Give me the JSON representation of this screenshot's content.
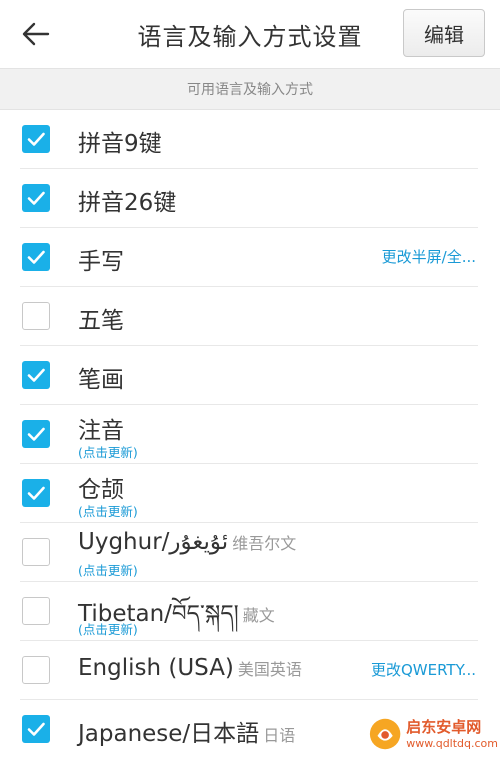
{
  "header": {
    "title": "语言及输入方式设置",
    "edit_label": "编辑"
  },
  "section": {
    "title": "可用语言及输入方式"
  },
  "colors": {
    "accent": "#1ab0e8",
    "link": "#1a9ad6"
  },
  "items": [
    {
      "label": "拼音9键",
      "extra": "",
      "sub": "",
      "checked": true,
      "action": ""
    },
    {
      "label": "拼音26键",
      "extra": "",
      "sub": "",
      "checked": true,
      "action": ""
    },
    {
      "label": "手写",
      "extra": "",
      "sub": "",
      "checked": true,
      "action": "更改半屏/全..."
    },
    {
      "label": "五笔",
      "extra": "",
      "sub": "",
      "checked": false,
      "action": ""
    },
    {
      "label": "笔画",
      "extra": "",
      "sub": "",
      "checked": true,
      "action": ""
    },
    {
      "label": "注音",
      "extra": "",
      "sub": "(点击更新)",
      "checked": true,
      "action": ""
    },
    {
      "label": "仓颉",
      "extra": "",
      "sub": "(点击更新)",
      "checked": true,
      "action": ""
    },
    {
      "label": "Uyghur/ئۇيغۇر",
      "extra": "维吾尔文",
      "sub": "(点击更新)",
      "checked": false,
      "action": ""
    },
    {
      "label": "Tibetan/བོད་སྐད།",
      "extra": "藏文",
      "sub": "(点击更新)",
      "checked": false,
      "action": ""
    },
    {
      "label": "English (USA)",
      "extra": "美国英语",
      "sub": "",
      "checked": false,
      "action": "更改QWERTY..."
    },
    {
      "label": "Japanese/日本語",
      "extra": "日语",
      "sub": "",
      "checked": true,
      "action": ""
    }
  ],
  "watermark": {
    "title": "启东安卓网",
    "url": "www.qdltdq.com"
  }
}
